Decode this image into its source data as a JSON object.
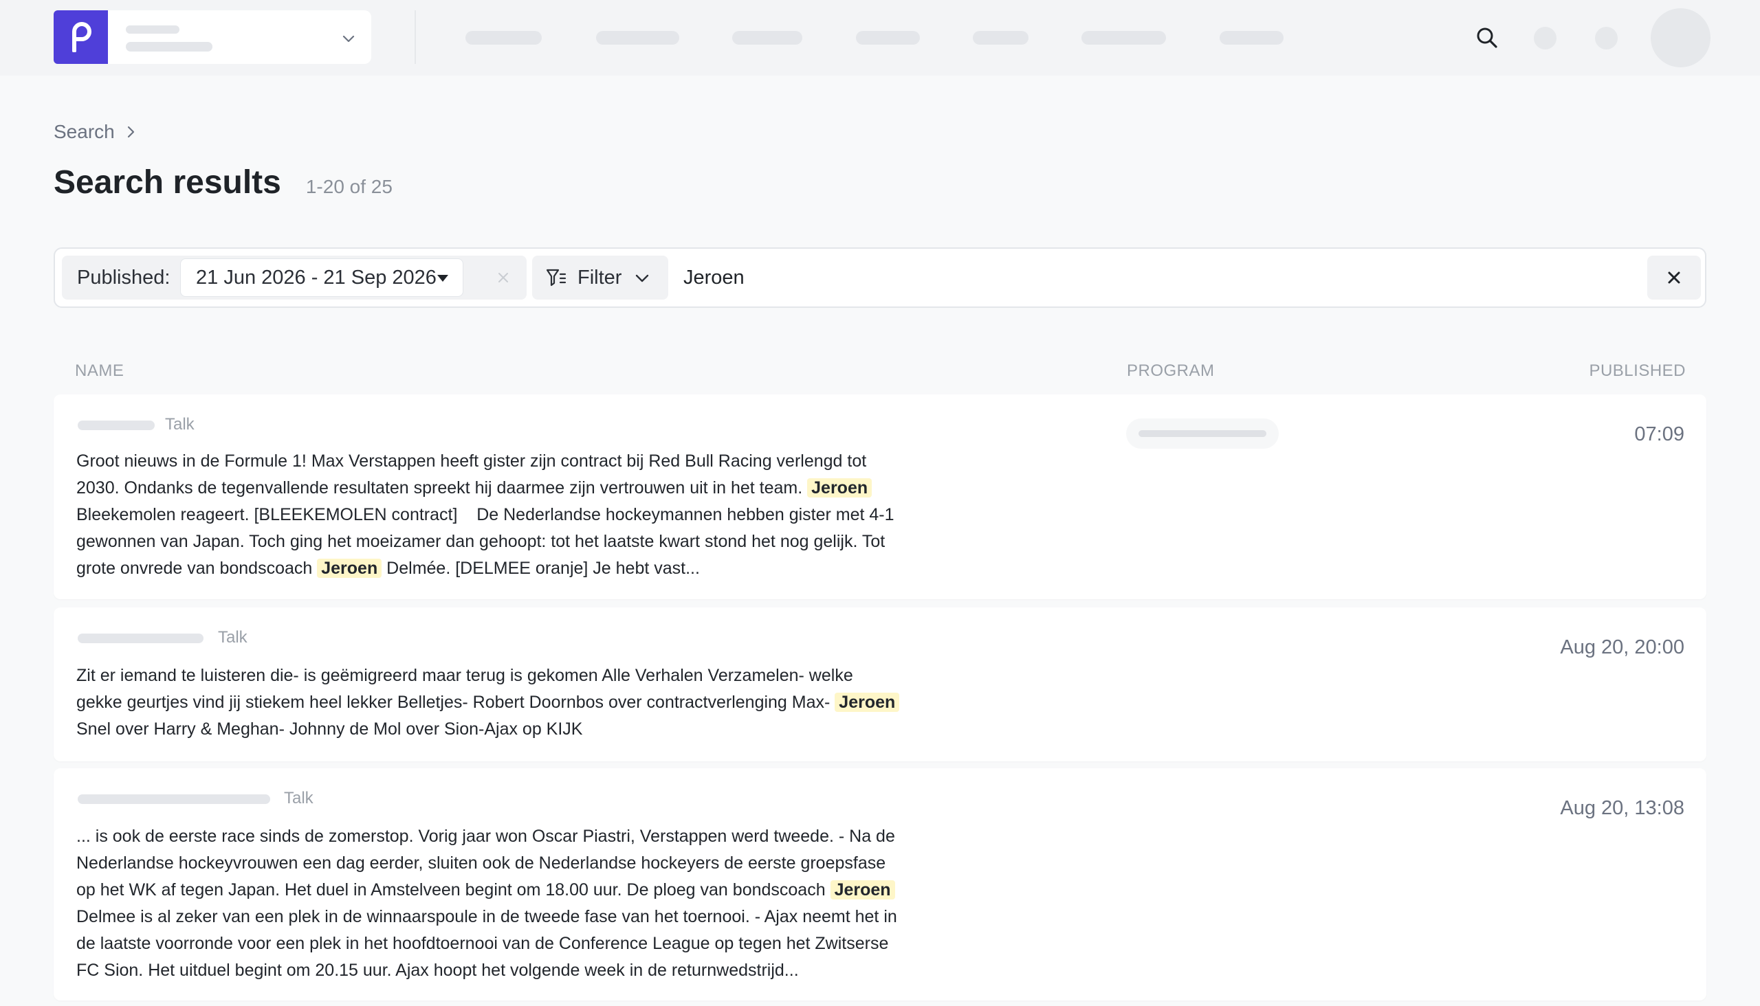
{
  "app": {
    "logo_letter": "p",
    "accent_color": "#4f3fd9"
  },
  "breadcrumb": {
    "root": "Search"
  },
  "header": {
    "title": "Search results",
    "count": "1-20 of 25"
  },
  "filters": {
    "published_label": "Published:",
    "date_range": "21 Jun 2026 - 21 Sep 2026",
    "filter_label": "Filter",
    "search_value": "Jeroen"
  },
  "columns": {
    "name": "NAME",
    "program": "PROGRAM",
    "published": "PUBLISHED"
  },
  "results": [
    {
      "type": "Talk",
      "time": "07:09",
      "snippet_parts": [
        "Groot nieuws in de Formule 1! Max Verstappen heeft gister zijn contract bij Red Bull Racing verlengd tot 2030. Ondanks de tegenvallende resultaten spreekt hij daarmee zijn vertrouwen uit in het team. ",
        "Jeroen",
        " Bleekemolen reageert. [BLEEKEMOLEN contract]    De Nederlandse hockeymannen hebben gister met 4-1 gewonnen van Japan. Toch ging het moeizamer dan gehoopt: tot het laatste kwart stond het nog gelijk. Tot grote onvrede van bondscoach ",
        "Jeroen",
        " Delmée. [DELMEE oranje] Je hebt vast..."
      ]
    },
    {
      "type": "Talk",
      "time": "Aug 20, 20:00",
      "snippet_parts": [
        "Zit er iemand te luisteren die- is geëmigreerd maar terug is gekomen Alle Verhalen Verzamelen- welke gekke geurtjes vind jij stiekem heel lekker Belletjes- Robert Doornbos over contractverlenging Max- ",
        "Jeroen",
        " Snel over Harry & Meghan- Johnny de Mol over Sion-Ajax op KIJK"
      ]
    },
    {
      "type": "Talk",
      "time": "Aug 20, 13:08",
      "snippet_parts": [
        "... is ook de eerste race sinds de zomerstop. Vorig jaar won Oscar Piastri, Verstappen werd tweede. - Na de Nederlandse hockeyvrouwen een dag eerder, sluiten ook de Nederlandse hockeyers de eerste groepsfase op het WK af tegen Japan. Het duel in Amstelveen begint om 18.00 uur. De ploeg van bondscoach ",
        "Jeroen",
        " Delmee is al zeker van een plek in de winnaarspoule in de tweede fase van het toernooi. - Ajax neemt het in de laatste voorronde voor een plek in het hoofdtoernooi van de Conference League op tegen het Zwitserse FC Sion. Het uitduel begint om 20.15 uur. Ajax hoopt het volgende week in de returnwedstrijd..."
      ]
    }
  ]
}
